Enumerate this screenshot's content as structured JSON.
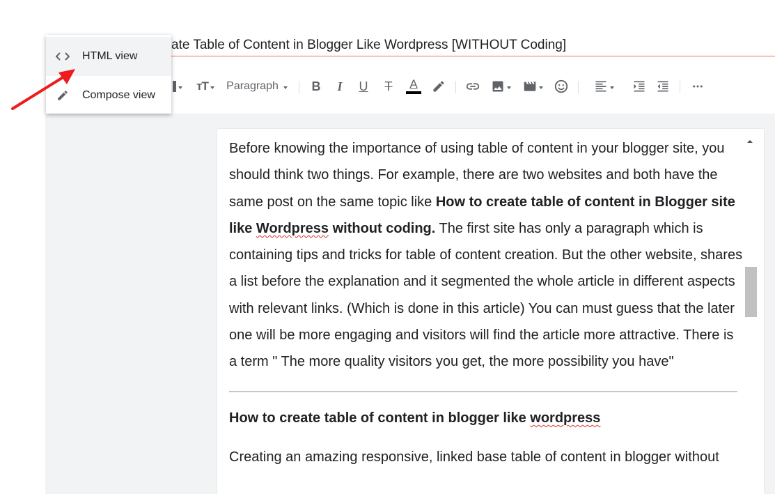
{
  "post_title": "ate Table of Content in Blogger Like Wordpress [WITHOUT Coding]",
  "menu": {
    "items": [
      {
        "label": "HTML view",
        "icon": "code-icon"
      },
      {
        "label": "Compose view",
        "icon": "pencil-icon"
      }
    ]
  },
  "toolbar": {
    "paragraph_label": "Paragraph",
    "icons": [
      "font-size-icon",
      "bold-icon",
      "italic-icon",
      "underline-icon",
      "strikethrough-icon",
      "text-color-icon",
      "highlight-icon",
      "link-icon",
      "image-icon",
      "video-icon",
      "emoji-icon",
      "align-icon",
      "indent-icon",
      "outdent-icon",
      "more-icon"
    ]
  },
  "doc": {
    "lines": [
      "Before knowing the importance of using table of content in your blogger site, you",
      "should think two things. For example, there are two websites and both have the",
      "same post on the same topic like "
    ],
    "bold_1": "How to create table of content in Blogger site",
    "bold_2a": "like ",
    "bold_2b": "Wordpress",
    "bold_2c": " without coding.",
    "after_bold": " The first site has only a paragraph which is",
    "lines_rest": [
      "containing tips and tricks for table of content creation. But the other website, shares",
      "a list before the explanation and it segmented the whole article in different aspects",
      "with relevant links. (Which is done in this article) You can must guess that the later",
      "one will be more engaging and visitors will find the article more attractive. There is",
      "a term \" The more quality visitors you get, the more possibility you have\""
    ],
    "heading_a": "How to create table of content in blogger like ",
    "heading_b": "wordpress",
    "para2": "Creating an amazing responsive, linked base table of content in blogger without"
  },
  "colors": {
    "accent_underline": "#ef6c5a",
    "arrow": "#ee1c1c",
    "editor_bg": "#f1f3f4"
  }
}
